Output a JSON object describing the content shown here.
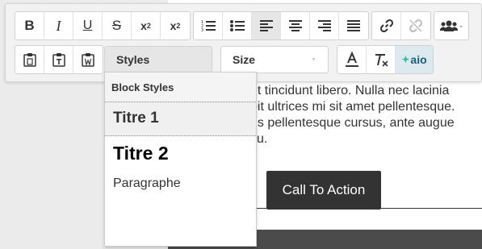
{
  "page": {
    "body_text": [
      "et tincidunt libero. Nulla nec lacinia",
      "bit ultrices mi sit amet pellentesque.",
      "us pellentesque cursus, ante augue",
      "cu."
    ],
    "cta_label": "Call To Action"
  },
  "toolbar": {
    "formatting": [
      {
        "name": "bold",
        "glyph": "B"
      },
      {
        "name": "italic",
        "glyph": "I"
      },
      {
        "name": "underline",
        "glyph": "U"
      },
      {
        "name": "strikethrough",
        "glyph": "S"
      },
      {
        "name": "subscript",
        "glyph": "x",
        "small": "2"
      },
      {
        "name": "superscript",
        "glyph": "x",
        "small": "2"
      }
    ],
    "styles_label": "Styles",
    "size_label": "Size",
    "aio_label": "aio",
    "aio_spark": "✦"
  },
  "styles_menu": {
    "header": "Block Styles",
    "items": [
      "Titre 1",
      "Titre 2",
      "Paragraphe"
    ]
  },
  "colors": {
    "accent_aio": "#1b5e7a",
    "cta_bg": "#333333"
  }
}
